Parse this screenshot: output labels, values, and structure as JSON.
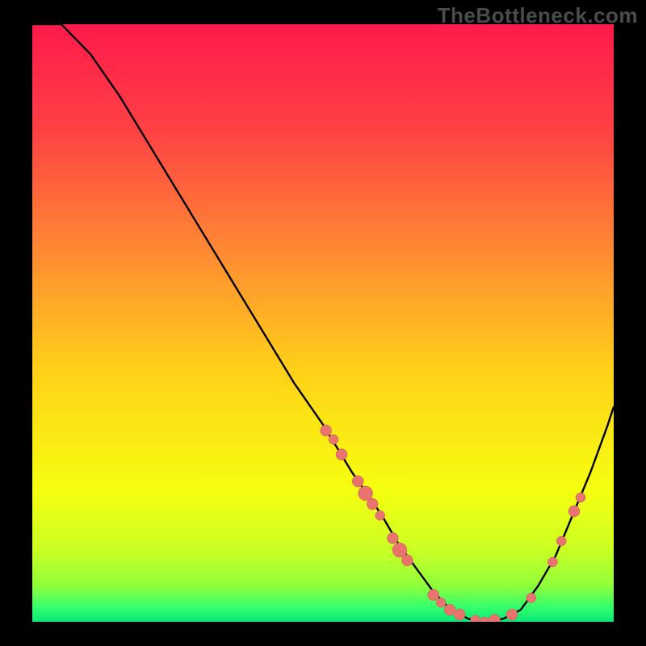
{
  "watermark": "TheBottleneck.com",
  "colors": {
    "background": "#000000",
    "gradient_stops": [
      {
        "offset": 0.0,
        "color": "#ff1a4b"
      },
      {
        "offset": 0.18,
        "color": "#ff4244"
      },
      {
        "offset": 0.38,
        "color": "#ff8a33"
      },
      {
        "offset": 0.58,
        "color": "#ffd118"
      },
      {
        "offset": 0.78,
        "color": "#f6ff10"
      },
      {
        "offset": 0.88,
        "color": "#caff24"
      },
      {
        "offset": 0.94,
        "color": "#8fff3a"
      },
      {
        "offset": 0.975,
        "color": "#35ff6d"
      },
      {
        "offset": 1.0,
        "color": "#09e876"
      }
    ],
    "curve": "#000000",
    "marker_fill": "#e9746d",
    "marker_stroke": "#c75a55"
  },
  "chart_data": {
    "type": "line",
    "title": "",
    "xlabel": "",
    "ylabel": "",
    "xlim": [
      0,
      100
    ],
    "ylim": [
      0,
      100
    ],
    "grid": false,
    "legend": false,
    "series": [
      {
        "name": "bottleneck-curve",
        "x": [
          0,
          5,
          10,
          15,
          20,
          25,
          30,
          35,
          40,
          45,
          50,
          55,
          60,
          63,
          66,
          69,
          72,
          75,
          78,
          81,
          84,
          87,
          90,
          93,
          96,
          99,
          100
        ],
        "y": [
          100,
          100,
          95,
          88,
          80,
          72,
          64,
          56,
          48,
          40,
          33,
          25,
          18,
          13,
          9,
          5,
          2,
          0.5,
          0,
          0.5,
          2,
          6,
          11,
          18,
          25,
          33,
          36
        ]
      }
    ],
    "markers": [
      {
        "x": 50.5,
        "y": 32.0,
        "r": 7
      },
      {
        "x": 51.8,
        "y": 30.5,
        "r": 6
      },
      {
        "x": 53.2,
        "y": 28.0,
        "r": 7
      },
      {
        "x": 56.0,
        "y": 23.5,
        "r": 7
      },
      {
        "x": 57.3,
        "y": 21.5,
        "r": 9
      },
      {
        "x": 58.5,
        "y": 19.7,
        "r": 7
      },
      {
        "x": 59.8,
        "y": 17.8,
        "r": 6
      },
      {
        "x": 62.0,
        "y": 14.0,
        "r": 7
      },
      {
        "x": 63.2,
        "y": 12.0,
        "r": 9
      },
      {
        "x": 64.5,
        "y": 10.3,
        "r": 7
      },
      {
        "x": 69.0,
        "y": 4.5,
        "r": 7
      },
      {
        "x": 70.3,
        "y": 3.2,
        "r": 6
      },
      {
        "x": 71.8,
        "y": 2.0,
        "r": 7
      },
      {
        "x": 73.5,
        "y": 1.2,
        "r": 7
      },
      {
        "x": 76.2,
        "y": 0.3,
        "r": 6
      },
      {
        "x": 77.8,
        "y": 0.0,
        "r": 6
      },
      {
        "x": 79.5,
        "y": 0.3,
        "r": 7
      },
      {
        "x": 82.5,
        "y": 1.2,
        "r": 7
      },
      {
        "x": 85.8,
        "y": 4.0,
        "r": 6
      },
      {
        "x": 89.5,
        "y": 10.0,
        "r": 6
      },
      {
        "x": 91.0,
        "y": 13.5,
        "r": 6
      },
      {
        "x": 93.2,
        "y": 18.5,
        "r": 7
      },
      {
        "x": 94.3,
        "y": 20.8,
        "r": 6
      }
    ]
  }
}
